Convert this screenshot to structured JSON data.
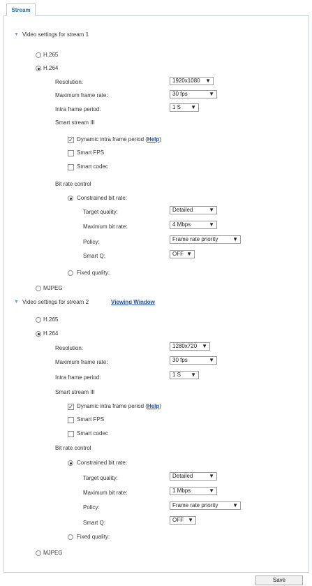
{
  "tab": {
    "label": "Stream"
  },
  "stream1": {
    "header": "Video settings for stream 1",
    "codec_h265": "H.265",
    "codec_h264": "H.264",
    "resolution_label": "Resolution:",
    "resolution_value": "1920x1080",
    "max_frame_rate_label": "Maximum frame rate:",
    "max_frame_rate_value": "30 fps",
    "intra_label": "Intra frame period:",
    "intra_value": "1 S",
    "smart_stream": "Smart stream III",
    "dynamic_intra_label": "Dynamic intra frame period (",
    "help": "Help",
    "close_paren": ")",
    "smart_fps": "Smart FPS",
    "smart_codec": "Smart codec",
    "bit_rate_control": "Bit rate control",
    "constrained": "Constrained bit rate:",
    "target_quality_label": "Target quality:",
    "target_quality_value": "Detailed",
    "max_bit_rate_label": "Maximum bit rate:",
    "max_bit_rate_value": "4 Mbps",
    "policy_label": "Policy:",
    "policy_value": "Frame rate priority",
    "smart_q_label": "Smart Q:",
    "smart_q_value": "OFF",
    "fixed_quality": "Fixed quality:",
    "mjpeg": "MJPEG"
  },
  "stream2": {
    "header": "Video settings for stream 2",
    "viewing_window": "Viewing Window",
    "codec_h265": "H.265",
    "codec_h264": "H.264",
    "resolution_label": "Resolution:",
    "resolution_value": "1280x720",
    "max_frame_rate_label": "Maximum frame rate:",
    "max_frame_rate_value": "30 fps",
    "intra_label": "Intra frame period:",
    "intra_value": "1 S",
    "smart_stream": "Smart stream III",
    "dynamic_intra_label": "Dynamic intra frame period (",
    "help": "Help",
    "close_paren": ")",
    "smart_fps": "Smart FPS",
    "smart_codec": "Smart codec",
    "bit_rate_control": "Bit rate control",
    "constrained": "Constrained bit rate:",
    "target_quality_label": "Target quality:",
    "target_quality_value": "Detailed",
    "max_bit_rate_label": "Maximum bit rate:",
    "max_bit_rate_value": "1 Mbps",
    "policy_label": "Policy:",
    "policy_value": "Frame rate priority",
    "smart_q_label": "Smart Q:",
    "smart_q_value": "OFF",
    "fixed_quality": "Fixed quality:",
    "mjpeg": "MJPEG"
  },
  "save_label": "Save",
  "icons": {
    "expand": "triangle-down-icon",
    "dropdown": "chevron-down-icon",
    "check": "check-icon"
  }
}
